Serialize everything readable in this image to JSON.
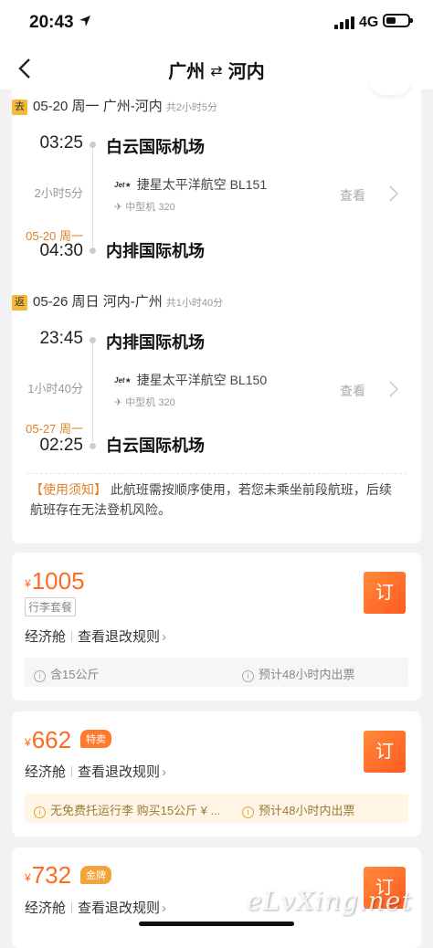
{
  "status_bar": {
    "time": "20:43",
    "network": "4G"
  },
  "nav": {
    "from": "广州",
    "to": "河内",
    "swap": "⇄"
  },
  "outbound": {
    "tag": "去",
    "date": "05-20 周一",
    "route": "广州-河内",
    "duration": "共2小时5分",
    "dep_time": "03:25",
    "dep_airport": "白云国际机场",
    "flight_duration": "2小时5分",
    "airline_logo": "Jet★",
    "airline": "捷星太平洋航空 BL151",
    "aircraft": "中型机 320",
    "view": "查看",
    "arr_date": "05-20 周一",
    "arr_time": "04:30",
    "arr_airport": "内排国际机场"
  },
  "return": {
    "tag": "返",
    "date": "05-26 周日",
    "route": "河内-广州",
    "duration": "共1小时40分",
    "dep_time": "23:45",
    "dep_airport": "内排国际机场",
    "flight_duration": "1小时40分",
    "airline_logo": "Jet★",
    "airline": "捷星太平洋航空 BL150",
    "aircraft": "中型机 320",
    "view": "查看",
    "arr_date": "05-27 周一",
    "arr_time": "02:25",
    "arr_airport": "白云国际机场"
  },
  "notice": {
    "label": "【使用须知】",
    "text": "此航班需按顺序使用，若您未乘坐前段航班，后续航班存在无法登机风险。"
  },
  "fares": [
    {
      "currency": "¥",
      "price": "1005",
      "package": "行李套餐",
      "cabin": "经济舱",
      "rules": "查看退改规则",
      "book": "订",
      "baggage": "含15公斤",
      "ticketing": "预计48小时内出票"
    },
    {
      "currency": "¥",
      "price": "662",
      "badge": "特卖",
      "cabin": "经济舱",
      "rules": "查看退改规则",
      "book": "订",
      "baggage": "无免费托运行李 购买15公斤 ¥ ...",
      "ticketing": "预计48小时内出票"
    },
    {
      "currency": "¥",
      "price": "732",
      "badge": "金牌",
      "cabin": "经济舱",
      "rules": "查看退改规则",
      "book": "订"
    }
  ],
  "watermark": "eLvXing.net",
  "colors": {
    "accent": "#ff6a21",
    "tag": "#f5b93a",
    "nextday": "#e0822a"
  }
}
